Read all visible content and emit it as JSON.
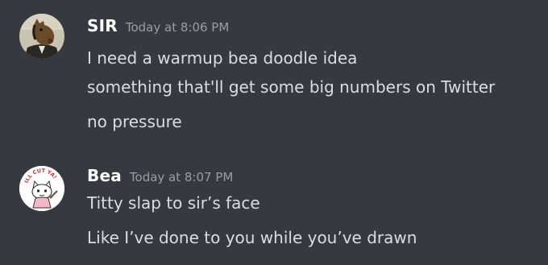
{
  "messages": [
    {
      "author": "SIR",
      "timestamp": "Today at 8:06 PM",
      "avatar_icon": "horse-head-avatar",
      "lines": [
        "I need a warmup bea doodle idea",
        "something that'll get some big numbers on Twitter",
        "no pressure"
      ]
    },
    {
      "author": "Bea",
      "timestamp": "Today at 8:07 PM",
      "avatar_icon": "cartoon-cat-avatar",
      "avatar_text": "ILL CUT YA!",
      "lines": [
        "Titty slap to sir’s face",
        "Like I’ve done to you while you’ve drawn"
      ]
    }
  ],
  "colors": {
    "background": "#36393f",
    "username": "#ffffff",
    "timestamp": "#9a9da3",
    "message_text": "#dcddde"
  }
}
